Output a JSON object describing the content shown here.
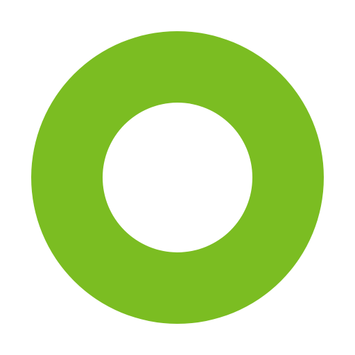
{
  "icon": {
    "name": "ring-icon",
    "shape": "ring",
    "colors": {
      "ring": "#7bbd22",
      "center": "#ffffff",
      "background": "#ffffff"
    }
  }
}
